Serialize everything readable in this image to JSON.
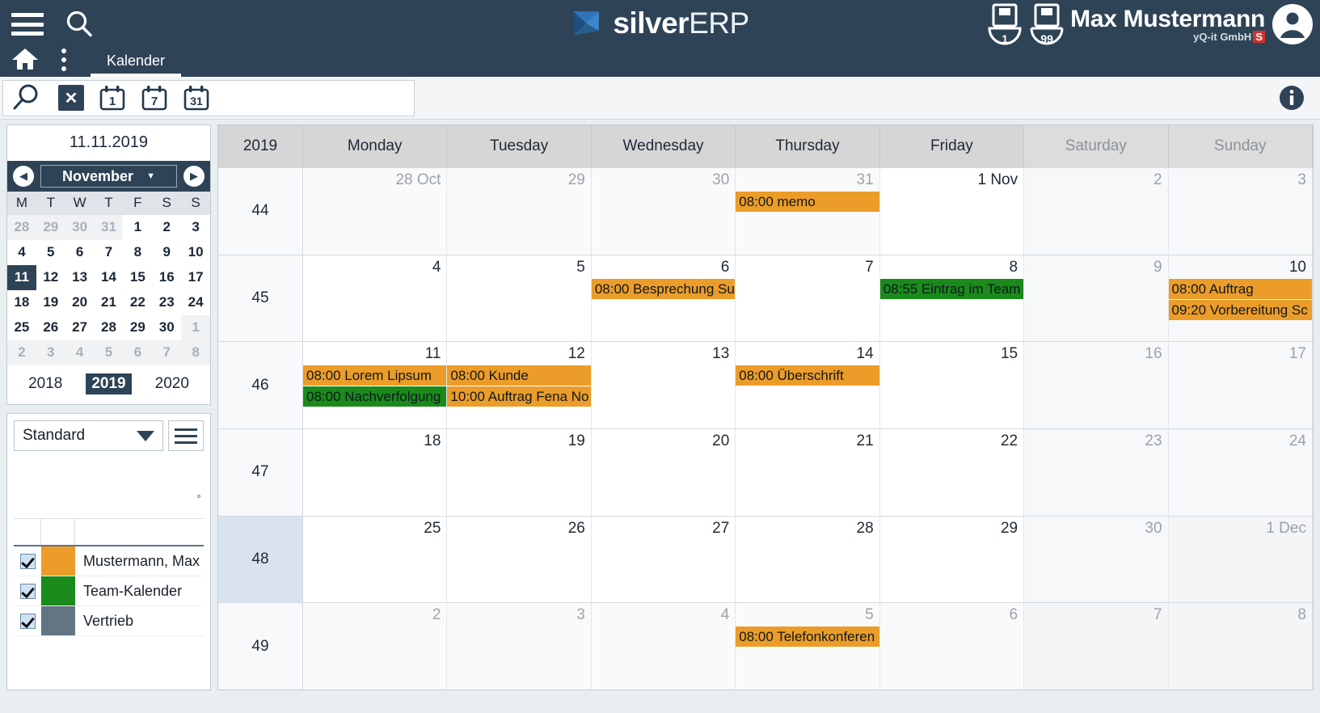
{
  "header": {
    "menu_icon": "hamburger-icon",
    "search_icon": "search-icon",
    "home_icon": "home-icon",
    "more_icon": "kebab-menu-icon",
    "tab_label": "Kalender",
    "logo_primary": "silver",
    "logo_secondary": "ERP",
    "tray_badges": [
      "1",
      "99"
    ],
    "user_name": "Max Mustermann",
    "user_company": "yQ-it GmbH",
    "user_company_badge": "S",
    "avatar_icon": "user-avatar-icon",
    "bar_color": "#2e4356"
  },
  "toolbar": {
    "search_icon": "magnifier-icon",
    "clear_label": "✕",
    "view_day_label": "1",
    "view_week_label": "7",
    "view_month_label": "31",
    "search_value": "",
    "search_placeholder": "",
    "info_icon": "info-icon"
  },
  "sidebar": {
    "selected_date": "11.11.2019",
    "month": "November",
    "prev_label": "◀",
    "next_label": "▶",
    "dow": [
      "M",
      "T",
      "W",
      "T",
      "F",
      "S",
      "S"
    ],
    "days": [
      {
        "n": "28",
        "out": true
      },
      {
        "n": "29",
        "out": true
      },
      {
        "n": "30",
        "out": true
      },
      {
        "n": "31",
        "out": true
      },
      {
        "n": "1"
      },
      {
        "n": "2"
      },
      {
        "n": "3"
      },
      {
        "n": "4"
      },
      {
        "n": "5"
      },
      {
        "n": "6"
      },
      {
        "n": "7"
      },
      {
        "n": "8"
      },
      {
        "n": "9"
      },
      {
        "n": "10"
      },
      {
        "n": "11",
        "sel": true
      },
      {
        "n": "12"
      },
      {
        "n": "13"
      },
      {
        "n": "14"
      },
      {
        "n": "15"
      },
      {
        "n": "16"
      },
      {
        "n": "17"
      },
      {
        "n": "18"
      },
      {
        "n": "19"
      },
      {
        "n": "20"
      },
      {
        "n": "21"
      },
      {
        "n": "22"
      },
      {
        "n": "23"
      },
      {
        "n": "24"
      },
      {
        "n": "25"
      },
      {
        "n": "26"
      },
      {
        "n": "27"
      },
      {
        "n": "28"
      },
      {
        "n": "29"
      },
      {
        "n": "30"
      },
      {
        "n": "1",
        "out": true
      },
      {
        "n": "2",
        "out": true
      },
      {
        "n": "3",
        "out": true
      },
      {
        "n": "4",
        "out": true
      },
      {
        "n": "5",
        "out": true
      },
      {
        "n": "6",
        "out": true
      },
      {
        "n": "7",
        "out": true
      },
      {
        "n": "8",
        "out": true
      }
    ],
    "years": [
      {
        "label": "2018"
      },
      {
        "label": "2019",
        "current": true
      },
      {
        "label": "2020"
      }
    ],
    "view_select": "Standard",
    "menu_icon": "list-menu-icon",
    "calendars": [
      {
        "label": "Mustermann, Max",
        "color": "#eb9c29",
        "checked": true
      },
      {
        "label": "Team-Kalender",
        "color": "#1a8a1a",
        "checked": true
      },
      {
        "label": "Vertrieb",
        "color": "#627584",
        "checked": true
      }
    ]
  },
  "calendar": {
    "year_label": "2019",
    "day_headers": [
      {
        "label": "Monday",
        "weekend": false
      },
      {
        "label": "Tuesday",
        "weekend": false
      },
      {
        "label": "Wednesday",
        "weekend": false
      },
      {
        "label": "Thursday",
        "weekend": false
      },
      {
        "label": "Friday",
        "weekend": false
      },
      {
        "label": "Saturday",
        "weekend": true
      },
      {
        "label": "Sunday",
        "weekend": true
      }
    ],
    "weeks": [
      {
        "week": "44",
        "current": false,
        "days": [
          {
            "num": "28 Oct",
            "dim": true,
            "other": true,
            "weekend": false,
            "events": []
          },
          {
            "num": "29",
            "dim": true,
            "other": true,
            "weekend": false,
            "events": []
          },
          {
            "num": "30",
            "dim": true,
            "other": true,
            "weekend": false,
            "events": []
          },
          {
            "num": "31",
            "dim": true,
            "other": true,
            "weekend": false,
            "events": [
              {
                "text": "08:00 memo",
                "color": "orange"
              }
            ]
          },
          {
            "num": "1 Nov",
            "dim": false,
            "other": false,
            "weekend": false,
            "events": []
          },
          {
            "num": "2",
            "dim": true,
            "other": false,
            "weekend": true,
            "events": []
          },
          {
            "num": "3",
            "dim": true,
            "other": false,
            "weekend": true,
            "events": []
          }
        ]
      },
      {
        "week": "45",
        "current": false,
        "days": [
          {
            "num": "4",
            "dim": false,
            "other": false,
            "weekend": false,
            "events": []
          },
          {
            "num": "5",
            "dim": false,
            "other": false,
            "weekend": false,
            "events": []
          },
          {
            "num": "6",
            "dim": false,
            "other": false,
            "weekend": false,
            "events": [
              {
                "text": "08:00 Besprechung Su",
                "color": "orange"
              }
            ]
          },
          {
            "num": "7",
            "dim": false,
            "other": false,
            "weekend": false,
            "events": []
          },
          {
            "num": "8",
            "dim": false,
            "other": false,
            "weekend": false,
            "events": [
              {
                "text": "08:55 Eintrag im Team",
                "color": "green"
              }
            ]
          },
          {
            "num": "9",
            "dim": true,
            "other": false,
            "weekend": true,
            "events": []
          },
          {
            "num": "10",
            "dim": false,
            "other": false,
            "weekend": true,
            "events": [
              {
                "text": "08:00 Auftrag",
                "color": "orange"
              },
              {
                "text": "09:20 Vorbereitung Sc",
                "color": "orange"
              }
            ]
          }
        ]
      },
      {
        "week": "46",
        "current": false,
        "days": [
          {
            "num": "11",
            "dim": false,
            "other": false,
            "weekend": false,
            "events": [
              {
                "text": "08:00 Lorem Lipsum",
                "color": "orange"
              },
              {
                "text": "08:00 Nachverfolgung",
                "color": "green"
              }
            ]
          },
          {
            "num": "12",
            "dim": false,
            "other": false,
            "weekend": false,
            "events": [
              {
                "text": "08:00 Kunde",
                "color": "orange"
              },
              {
                "text": "10:00 Auftrag Fena No",
                "color": "orange"
              }
            ]
          },
          {
            "num": "13",
            "dim": false,
            "other": false,
            "weekend": false,
            "events": []
          },
          {
            "num": "14",
            "dim": false,
            "other": false,
            "weekend": false,
            "events": [
              {
                "text": "08:00 Überschrift",
                "color": "orange"
              }
            ]
          },
          {
            "num": "15",
            "dim": false,
            "other": false,
            "weekend": false,
            "events": []
          },
          {
            "num": "16",
            "dim": true,
            "other": false,
            "weekend": true,
            "events": []
          },
          {
            "num": "17",
            "dim": true,
            "other": false,
            "weekend": true,
            "events": []
          }
        ]
      },
      {
        "week": "47",
        "current": false,
        "days": [
          {
            "num": "18",
            "dim": false,
            "other": false,
            "weekend": false,
            "events": []
          },
          {
            "num": "19",
            "dim": false,
            "other": false,
            "weekend": false,
            "events": []
          },
          {
            "num": "20",
            "dim": false,
            "other": false,
            "weekend": false,
            "events": []
          },
          {
            "num": "21",
            "dim": false,
            "other": false,
            "weekend": false,
            "events": []
          },
          {
            "num": "22",
            "dim": false,
            "other": false,
            "weekend": false,
            "events": []
          },
          {
            "num": "23",
            "dim": true,
            "other": false,
            "weekend": true,
            "events": []
          },
          {
            "num": "24",
            "dim": true,
            "other": false,
            "weekend": true,
            "events": []
          }
        ]
      },
      {
        "week": "48",
        "current": true,
        "days": [
          {
            "num": "25",
            "dim": false,
            "other": false,
            "weekend": false,
            "events": []
          },
          {
            "num": "26",
            "dim": false,
            "other": false,
            "weekend": false,
            "events": []
          },
          {
            "num": "27",
            "dim": false,
            "other": false,
            "weekend": false,
            "events": []
          },
          {
            "num": "28",
            "dim": false,
            "other": false,
            "weekend": false,
            "events": []
          },
          {
            "num": "29",
            "dim": false,
            "other": false,
            "weekend": false,
            "events": []
          },
          {
            "num": "30",
            "dim": true,
            "other": false,
            "weekend": true,
            "events": []
          },
          {
            "num": "1 Dec",
            "dim": true,
            "other": true,
            "weekend": true,
            "events": []
          }
        ]
      },
      {
        "week": "49",
        "current": false,
        "days": [
          {
            "num": "2",
            "dim": true,
            "other": true,
            "weekend": false,
            "events": []
          },
          {
            "num": "3",
            "dim": true,
            "other": true,
            "weekend": false,
            "events": []
          },
          {
            "num": "4",
            "dim": true,
            "other": true,
            "weekend": false,
            "events": []
          },
          {
            "num": "5",
            "dim": true,
            "other": true,
            "weekend": false,
            "events": [
              {
                "text": "08:00 Telefonkonferen",
                "color": "orange"
              }
            ]
          },
          {
            "num": "6",
            "dim": true,
            "other": true,
            "weekend": false,
            "events": []
          },
          {
            "num": "7",
            "dim": true,
            "other": true,
            "weekend": true,
            "events": []
          },
          {
            "num": "8",
            "dim": true,
            "other": true,
            "weekend": true,
            "events": []
          }
        ]
      }
    ]
  }
}
